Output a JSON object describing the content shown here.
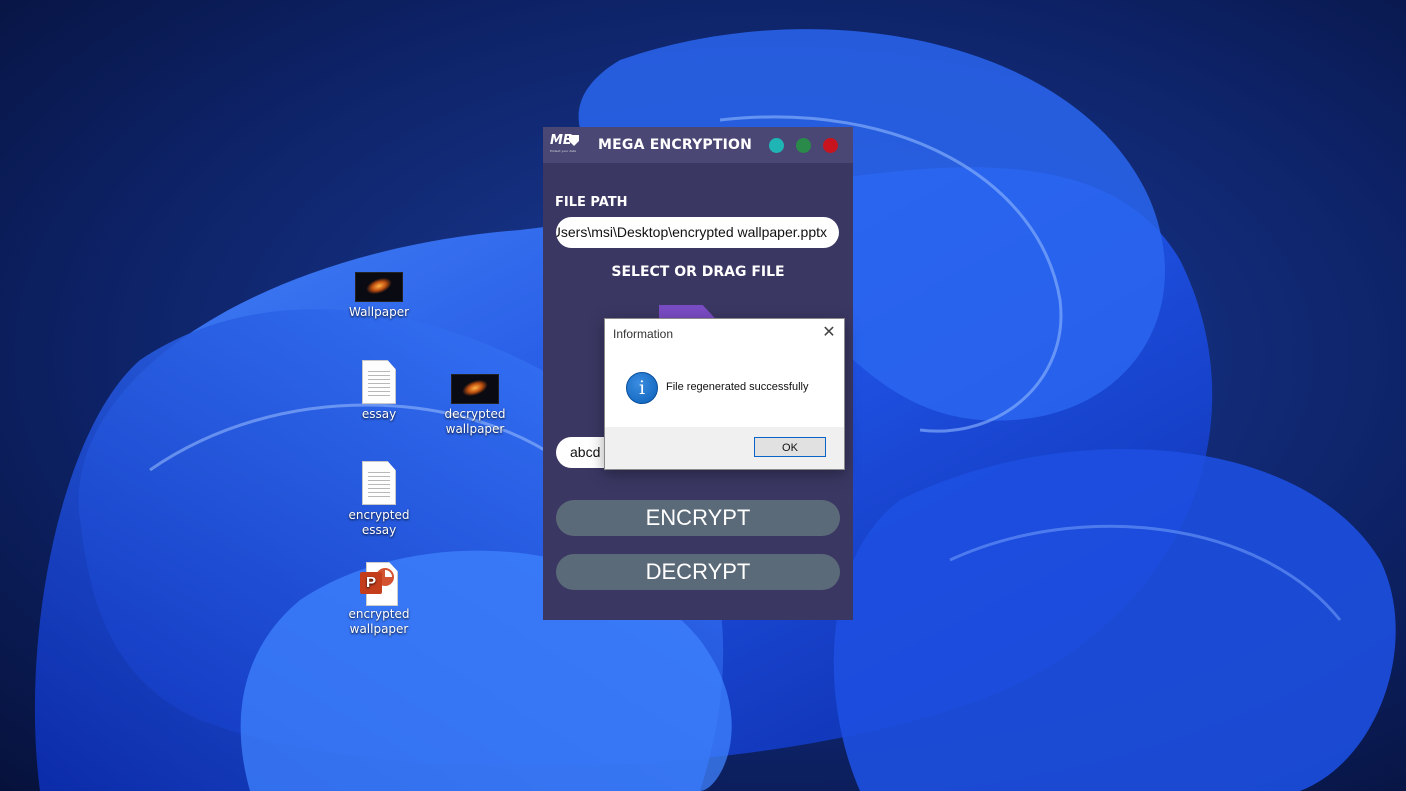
{
  "desktop": {
    "icons": [
      {
        "label": "Wallpaper",
        "type": "image"
      },
      {
        "label": "essay",
        "type": "text"
      },
      {
        "label": "decrypted wallpaper",
        "type": "image"
      },
      {
        "label": "encrypted essay",
        "type": "text"
      },
      {
        "label": "encrypted wallpaper",
        "type": "powerpoint"
      }
    ]
  },
  "app": {
    "logo_text": "ME",
    "logo_tagline": "Protect your data",
    "title": "MEGA ENCRYPTION",
    "controls": {
      "minimize_color": "#1fb5b5",
      "maximize_color": "#2a8a4a",
      "close_color": "#c8141e"
    },
    "file_path_label": "FILE PATH",
    "file_path_value": "C:\\Users\\msi\\Desktop\\encrypted wallpaper.pptx",
    "select_label": "SELECT OR DRAG FILE",
    "key_value": "abcd",
    "encrypt_label": "ENCRYPT",
    "decrypt_label": "DECRYPT"
  },
  "dialog": {
    "title": "Information",
    "close_glyph": "✕",
    "icon": "information-icon",
    "icon_glyph": "i",
    "message": "File regenerated successfully",
    "ok_label": "OK"
  }
}
